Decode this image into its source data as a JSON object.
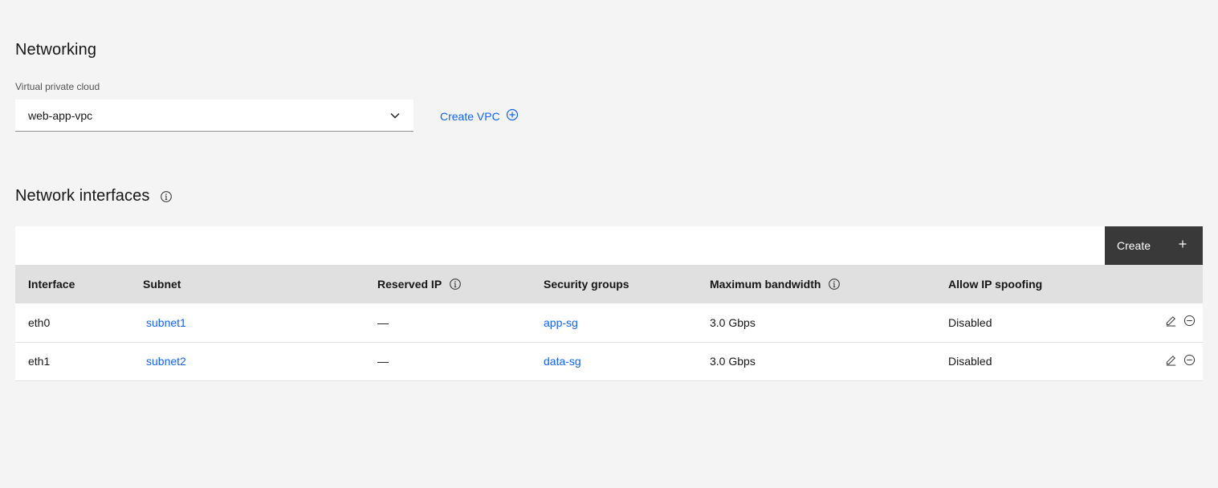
{
  "networking": {
    "title": "Networking",
    "vpc_label": "Virtual private cloud",
    "vpc_value": "web-app-vpc",
    "create_vpc_label": "Create VPC"
  },
  "interfaces": {
    "title": "Network interfaces",
    "create_label": "Create",
    "columns": [
      "Interface",
      "Subnet",
      "Reserved IP",
      "Security groups",
      "Maximum bandwidth",
      "Allow IP spoofing"
    ],
    "rows": [
      {
        "interface": "eth0",
        "subnet": "subnet1",
        "reserved_ip": "—",
        "security_group": "app-sg",
        "bandwidth": "3.0 Gbps",
        "ip_spoofing": "Disabled"
      },
      {
        "interface": "eth1",
        "subnet": "subnet2",
        "reserved_ip": "—",
        "security_group": "data-sg",
        "bandwidth": "3.0 Gbps",
        "ip_spoofing": "Disabled"
      }
    ]
  },
  "colors": {
    "link": "#0f62fe",
    "background": "#f4f4f4",
    "header_row": "#e0e0e0",
    "button_dark": "#393939"
  },
  "icons": [
    "chevron-down-icon",
    "add-circle-icon",
    "info-icon",
    "add-icon",
    "edit-icon",
    "remove-icon"
  ]
}
